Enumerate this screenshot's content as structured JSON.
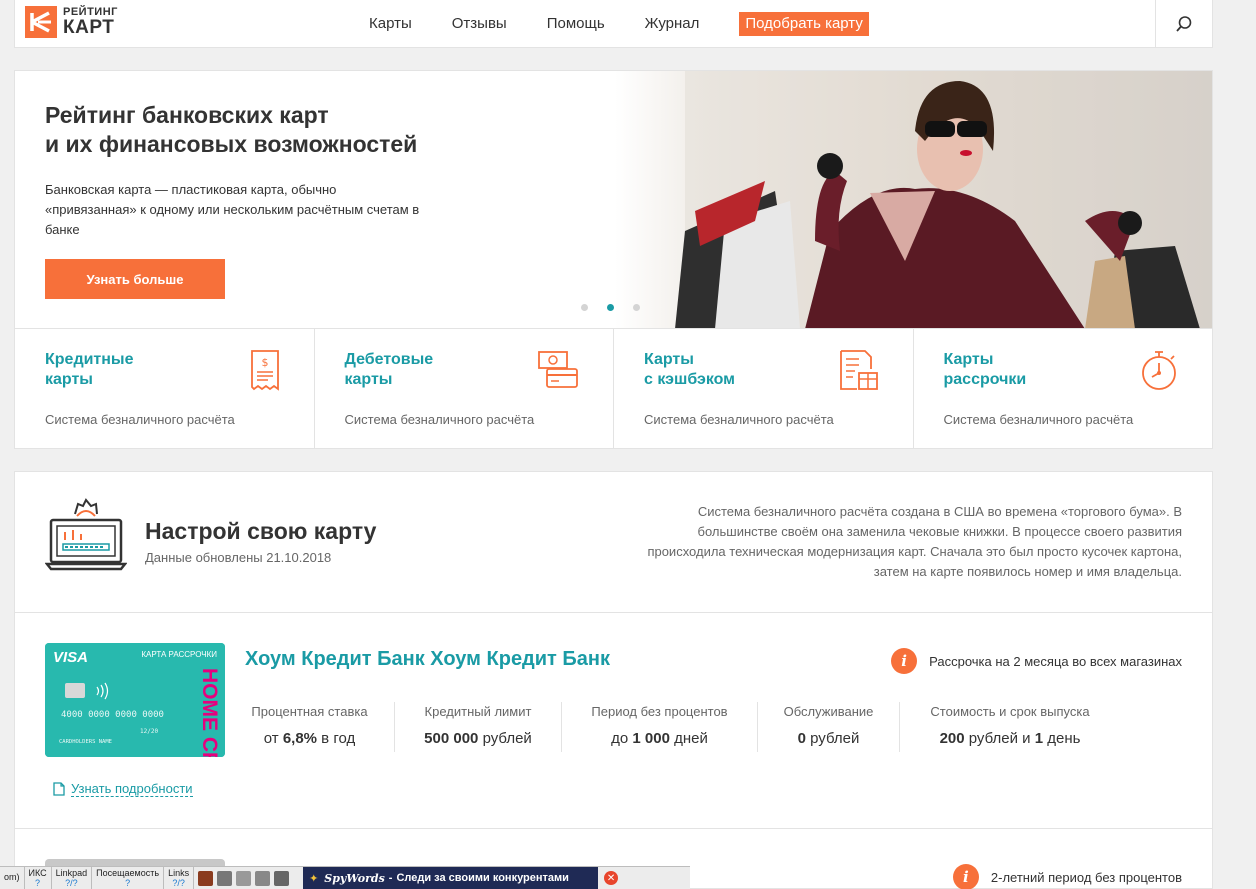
{
  "header": {
    "logo_small": "РЕЙТИНГ",
    "logo_big": "КАРТ",
    "nav": [
      "Карты",
      "Отзывы",
      "Помощь",
      "Журнал"
    ],
    "cta": "Подобрать карту"
  },
  "hero": {
    "title": "Рейтинг банковских карт\nи их финансовых возможностей",
    "text": "Банковская карта — пластиковая карта, обычно «привязанная» к одному или нескольким расчётным счетам в банке",
    "button": "Узнать больше",
    "slides": 3,
    "active_slide": 2
  },
  "categories": [
    {
      "title": "Кредитные\nкарты",
      "subtitle": "Система безналичного расчёта",
      "icon": "receipt-icon"
    },
    {
      "title": "Дебетовые\nкарты",
      "subtitle": "Система безналичного расчёта",
      "icon": "cash-card-icon"
    },
    {
      "title": "Карты\nс кэшбэком",
      "subtitle": "Система безналичного расчёта",
      "icon": "gift-list-icon"
    },
    {
      "title": "Карты\nрассрочки",
      "subtitle": "Система безналичного расчёта",
      "icon": "stopwatch-icon"
    }
  ],
  "config": {
    "title": "Настрой свою карту",
    "updated": "Данные обновлены 21.10.2018",
    "description": "Система безналичного расчёта создана в США во времена «торгового бума». В большинстве своём она заменила чековые книжки. В процессе своего развития происходила техническая модернизация карт. Сначала это был просто кусочек картона, затем на карте появилось номер и имя владельца."
  },
  "offers": [
    {
      "bank": "Хоум Кредит Банк Хоум Кредит Банк",
      "badge": "Рассрочка на 2 месяца во всех магазинах",
      "card": {
        "brand": "VISA",
        "type": "КАРТА РАССРОЧКИ",
        "number": "4000  0000  0000  0000",
        "expiry": "12/20",
        "holder": "CARDHOLDERS NAME",
        "bank_text": "HOME CREDIT BANK"
      },
      "params": [
        {
          "label": "Процентная ставка",
          "prefix": "от ",
          "value": "6,8%",
          "suffix": " в год"
        },
        {
          "label": "Кредитный лимит",
          "prefix": "",
          "value": "500 000",
          "suffix": " рублей"
        },
        {
          "label": "Период без процентов",
          "prefix": "до ",
          "value": "1 000",
          "suffix": " дней"
        },
        {
          "label": "Обслуживание",
          "prefix": "",
          "value": "0",
          "suffix": " рублей"
        },
        {
          "label": "Стоимость и срок выпуска",
          "prefix": "",
          "value": "200",
          "suffix": " рублей и ",
          "value2": "1",
          "suffix2": " день"
        }
      ],
      "details_link": "Узнать подробности"
    },
    {
      "badge": "2-летний период без процентов"
    }
  ],
  "toolbar": {
    "left_cut": "om)",
    "cells": [
      {
        "label": "ИКС",
        "value": "?"
      },
      {
        "label": "Linkpad",
        "value": "?/?"
      },
      {
        "label": "Посещаемость",
        "value": "?"
      },
      {
        "label": "Links",
        "value": "?/?"
      }
    ],
    "spywords": "SpyWords - Следи за своими конкурентами",
    "spywords_logo": "SpyWords",
    "spywords_tagline": "Следи за своими конкурентами"
  },
  "colors": {
    "accent": "#f7703a",
    "teal": "#1a9ba5"
  }
}
